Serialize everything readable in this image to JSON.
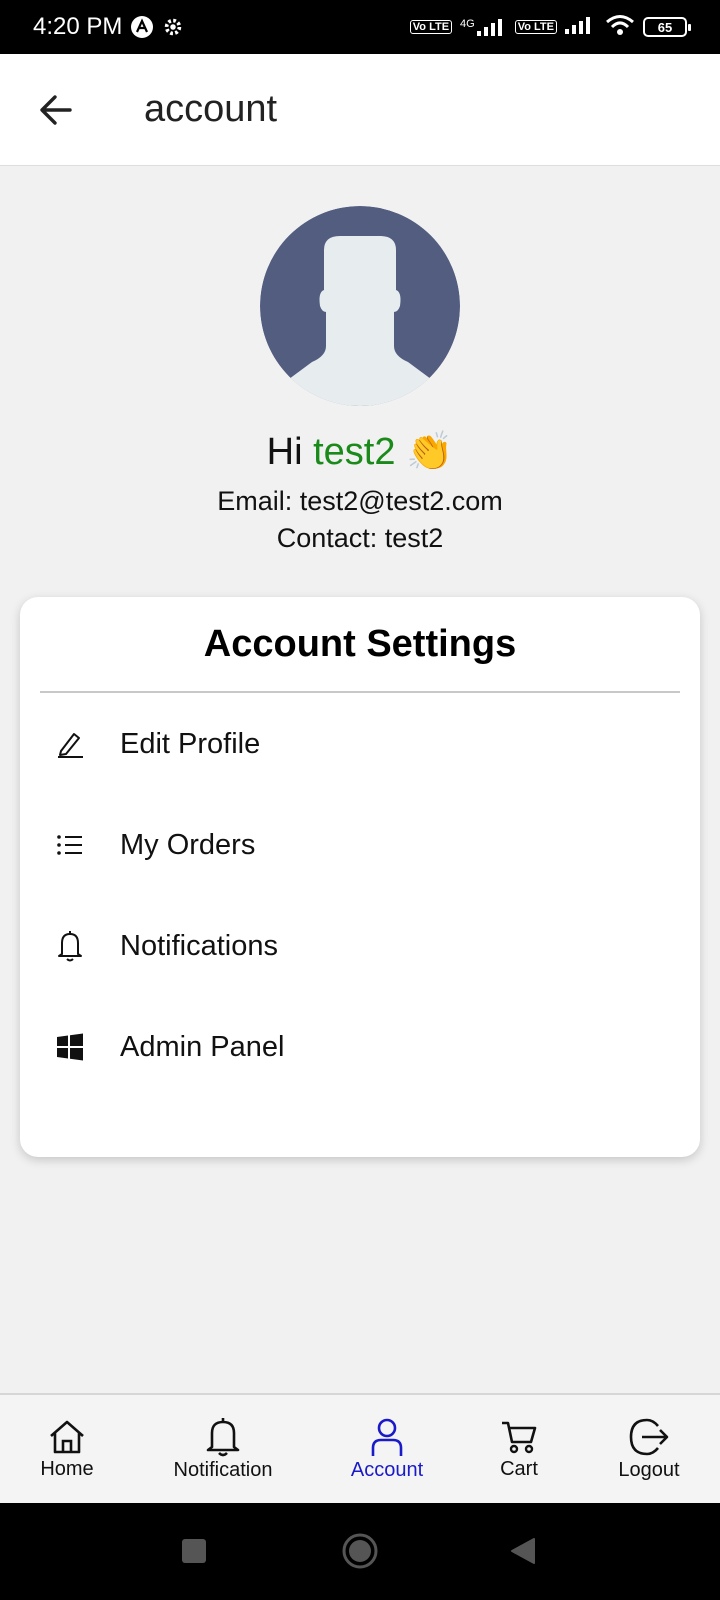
{
  "status_bar": {
    "time": "4:20 PM",
    "net_label_1": "Vo LTE",
    "net_type": "4G",
    "net_label_2": "Vo LTE",
    "battery": "65",
    "icons": [
      "alert-a-icon",
      "settings-gear-icon",
      "signal-icon",
      "wifi-icon",
      "battery-icon"
    ]
  },
  "app_bar": {
    "title": "account",
    "back_icon": "arrow-left-icon"
  },
  "profile": {
    "greeting_prefix": "Hi",
    "username": "test2",
    "emoji": "👏",
    "email_line": "Email: test2@test2.com",
    "contact_line": "Contact: test2",
    "colors": {
      "username": "#1a8a1a",
      "avatar_bg": "#525d80",
      "avatar_fg": "#e7ecee"
    }
  },
  "settings": {
    "title": "Account Settings",
    "items": [
      {
        "label": "Edit Profile",
        "icon": "pencil-icon"
      },
      {
        "label": "My Orders",
        "icon": "list-icon"
      },
      {
        "label": "Notifications",
        "icon": "bell-icon"
      },
      {
        "label": "Admin Panel",
        "icon": "windows-icon"
      }
    ]
  },
  "bottom_nav": {
    "items": [
      {
        "label": "Home",
        "icon": "home-icon",
        "active": false
      },
      {
        "label": "Notification",
        "icon": "bell-icon",
        "active": false
      },
      {
        "label": "Account",
        "icon": "user-icon",
        "active": true
      },
      {
        "label": "Cart",
        "icon": "cart-icon",
        "active": false
      },
      {
        "label": "Logout",
        "icon": "logout-icon",
        "active": false
      }
    ],
    "active_color": "#1a1ac8"
  },
  "system_nav": {
    "icons": [
      "recents-square-icon",
      "home-circle-icon",
      "back-triangle-icon"
    ]
  }
}
